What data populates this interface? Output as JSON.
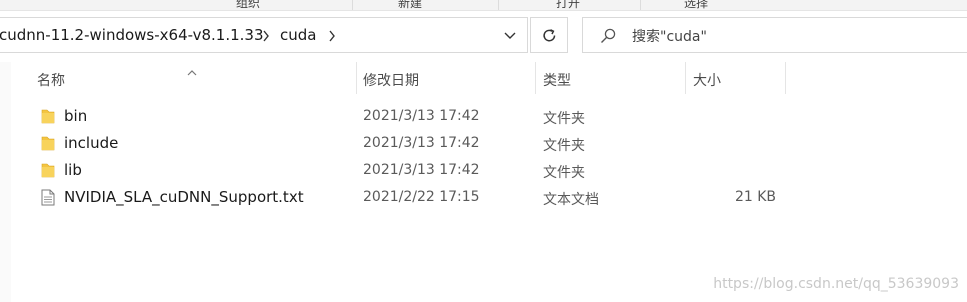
{
  "ribbon": {
    "labels": [
      "组织",
      "新建",
      "打开",
      "选择"
    ]
  },
  "address": {
    "crumbs": [
      "cudnn-11.2-windows-x64-v8.1.1.33",
      "cuda"
    ]
  },
  "search": {
    "placeholder": "搜索\"cuda\""
  },
  "columns": {
    "name": "名称",
    "date": "修改日期",
    "type": "类型",
    "size": "大小"
  },
  "files": [
    {
      "name": "bin",
      "date": "2021/3/13 17:42",
      "type": "文件夹",
      "size": "",
      "icon": "folder-icon"
    },
    {
      "name": "include",
      "date": "2021/3/13 17:42",
      "type": "文件夹",
      "size": "",
      "icon": "folder-icon"
    },
    {
      "name": "lib",
      "date": "2021/3/13 17:42",
      "type": "文件夹",
      "size": "",
      "icon": "folder-icon"
    },
    {
      "name": "NVIDIA_SLA_cuDNN_Support.txt",
      "date": "2021/2/22 17:15",
      "type": "文本文档",
      "size": "21 KB",
      "icon": "text-file-icon"
    }
  ],
  "watermark": "https://blog.csdn.net/qq_53639093",
  "colors": {
    "folder": "#f4c542",
    "border": "#d9d9d9"
  }
}
